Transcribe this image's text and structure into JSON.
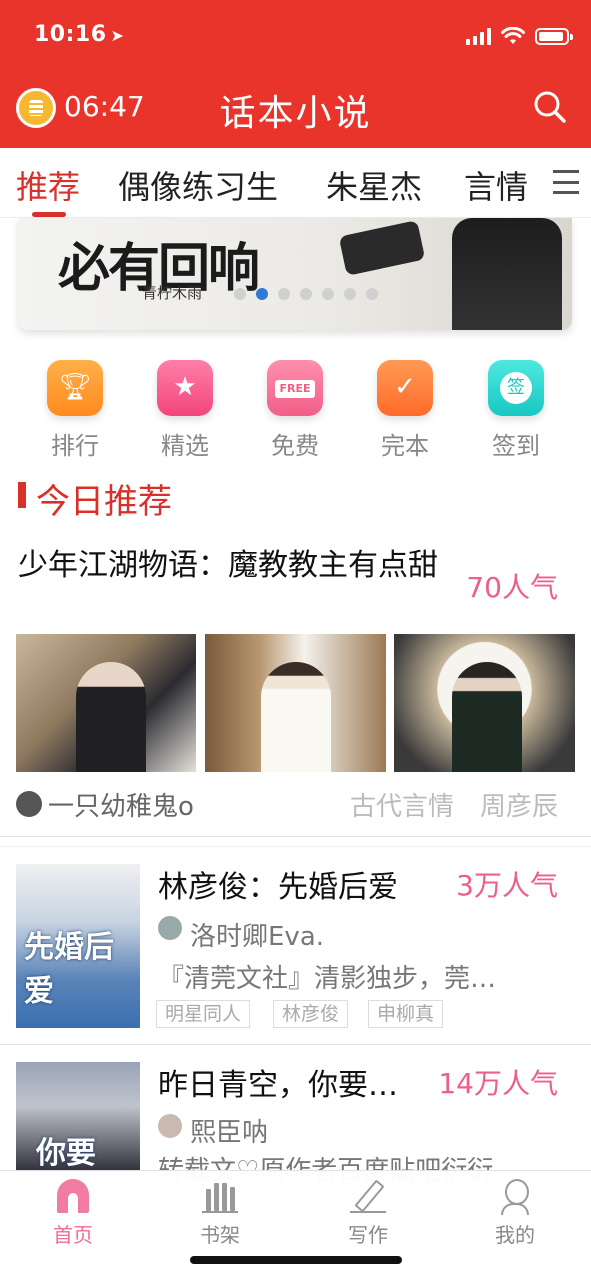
{
  "status_bar": {
    "time": "10:16"
  },
  "header": {
    "alarm_time": "06:47",
    "title": "话本小说"
  },
  "tabs": [
    {
      "label": "推荐"
    },
    {
      "label": "偶像练习生"
    },
    {
      "label": "朱星杰"
    },
    {
      "label": "言情"
    }
  ],
  "banner": {
    "title_art": "必有回响",
    "author": "青柠木雨",
    "page_count": 7,
    "active_page": 2
  },
  "categories": [
    {
      "label": "排行",
      "icon": "trophy-icon"
    },
    {
      "label": "精选",
      "icon": "star-icon"
    },
    {
      "label": "免费",
      "icon": "free-sign-icon",
      "badge": "FREE"
    },
    {
      "label": "完本",
      "icon": "check-book-icon"
    },
    {
      "label": "签到",
      "icon": "sign-in-icon",
      "badge": "签"
    }
  ],
  "section": {
    "title": "今日推荐"
  },
  "featured": {
    "title": "少年江湖物语：魔教教主有点甜",
    "popularity": "70人气",
    "author": "一只幼稚鬼o",
    "tags": [
      "古代言情",
      "周彦辰"
    ]
  },
  "items": [
    {
      "title": "林彦俊：先婚后爱",
      "popularity": "3万人气",
      "author": "洛时卿Eva.",
      "description": "『清莞文社』清影独步，莞…",
      "tags": [
        "明星同人",
        "林彦俊",
        "申柳真"
      ],
      "cover_text": "先婚后爱"
    },
    {
      "title": "昨日青空，你要…",
      "popularity": "14万人气",
      "author": "熙臣呐",
      "description": "转载文♡原作者百度贴吧衍衍",
      "cover_text": "你要"
    }
  ],
  "bottom_nav": [
    {
      "label": "首页",
      "icon": "home-icon",
      "active": true
    },
    {
      "label": "书架",
      "icon": "bookshelf-icon",
      "active": false
    },
    {
      "label": "写作",
      "icon": "pen-icon",
      "active": false
    },
    {
      "label": "我的",
      "icon": "profile-icon",
      "active": false
    }
  ],
  "colors": {
    "header_bg": "#e8342b",
    "accent_red": "#d9302a",
    "popularity_pink": "#ec5f8c",
    "nav_active": "#ee6e97"
  }
}
